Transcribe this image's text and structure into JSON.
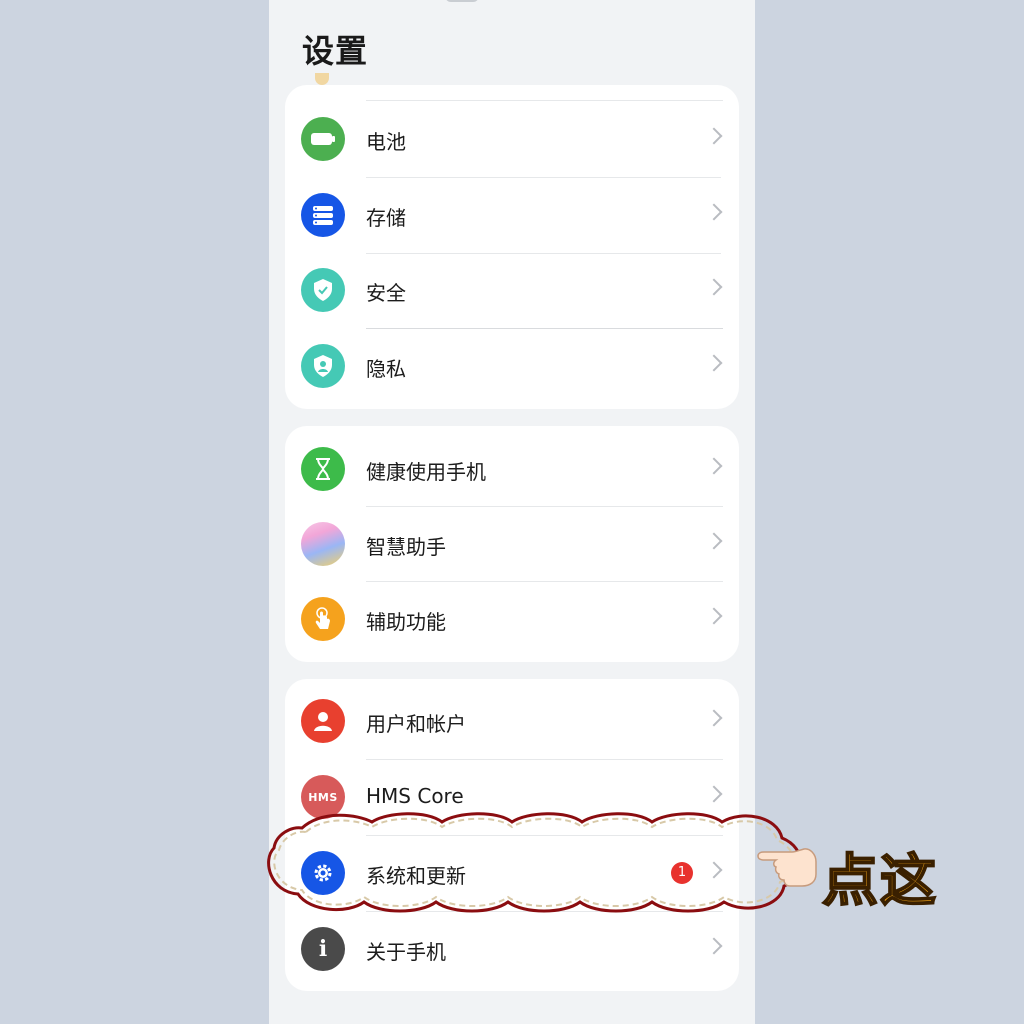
{
  "page": {
    "title": "设置"
  },
  "card1": {
    "items": [
      {
        "label": "电池",
        "icon": "battery-icon",
        "color": "#4caf50"
      },
      {
        "label": "存储",
        "icon": "storage-icon",
        "color": "#1656e6"
      },
      {
        "label": "安全",
        "icon": "shield-check-icon",
        "color": "#45c9b5"
      },
      {
        "label": "隐私",
        "icon": "privacy-shield-icon",
        "color": "#45c9b5"
      }
    ]
  },
  "card2": {
    "items": [
      {
        "label": "健康使用手机",
        "icon": "hourglass-icon",
        "color": "#3dbb4a"
      },
      {
        "label": "智慧助手",
        "icon": "assistant-orb-icon",
        "color": "#e98bd2"
      },
      {
        "label": "辅助功能",
        "icon": "hand-tap-icon",
        "color": "#f5a21d"
      }
    ]
  },
  "card3": {
    "items": [
      {
        "label": "用户和帐户",
        "icon": "user-icon",
        "color": "#e8402f"
      },
      {
        "label": "HMS Core",
        "icon": "hms-icon",
        "icon_text": "HMS",
        "color": "#d75a5a"
      },
      {
        "label": "系统和更新",
        "icon": "gear-icon",
        "color": "#1656e6",
        "badge": "1"
      },
      {
        "label": "关于手机",
        "icon": "info-icon",
        "icon_text": "i",
        "color": "#4a4a4a"
      }
    ]
  },
  "annotation": {
    "text": "点这",
    "color": "#f5a718"
  }
}
